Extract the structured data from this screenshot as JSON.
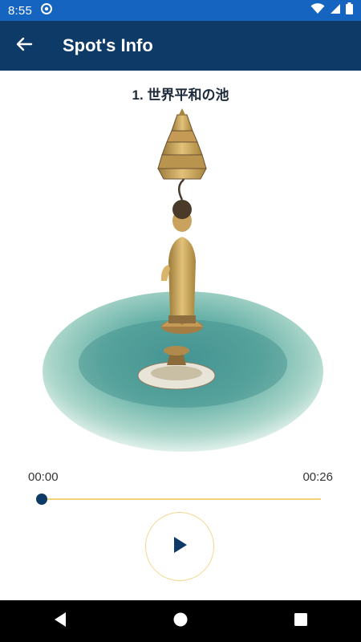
{
  "status_bar": {
    "time": "8:55",
    "icons": [
      "data-saver-icon",
      "wifi-icon",
      "signal-icon",
      "battery-icon"
    ]
  },
  "app_bar": {
    "title": "Spot's Info",
    "back_icon": "arrow-left-icon"
  },
  "spot": {
    "title": "1. 世界平和の池"
  },
  "player": {
    "current_time": "00:00",
    "total_time": "00:26",
    "progress": 0,
    "play_icon": "play-icon"
  },
  "nav_bar": {
    "icons": [
      "back-triangle-icon",
      "home-circle-icon",
      "recents-square-icon"
    ]
  },
  "colors": {
    "status_bar": "#1565c0",
    "app_bar": "#0d3a66",
    "accent_gold": "#f0d27a",
    "seek_thumb": "#0d3a66",
    "nav_bar": "#000000"
  }
}
